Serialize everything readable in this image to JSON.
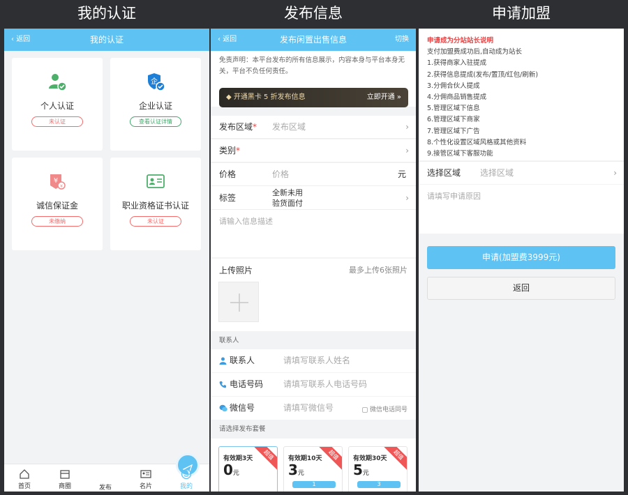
{
  "captions": [
    "我的认证",
    "发布信息",
    "申请加盟"
  ],
  "colors": {
    "accent": "#5ec2f3",
    "danger": "#f36b6b",
    "success": "#3fa86a"
  },
  "panel1": {
    "back": "返回",
    "title": "我的认证",
    "cards": [
      {
        "name": "个人认证",
        "status": "未认证",
        "icon": "person-check-icon"
      },
      {
        "name": "企业认证",
        "status": "查看认证详情",
        "icon": "shield-check-icon"
      },
      {
        "name": "诚信保证金",
        "status": "未缴纳",
        "icon": "yen-badge-icon"
      },
      {
        "name": "职业资格证书认证",
        "status": "未认证",
        "icon": "id-card-icon"
      }
    ],
    "tabs": [
      "首页",
      "商圈",
      "发布",
      "名片",
      "我的"
    ]
  },
  "panel2": {
    "back": "返回",
    "title": "发布闲置出售信息",
    "switch": "切换",
    "disclaimer": "免责声明：本平台发布的所有信息展示，内容本身与平台本身无关，平台不负任何责任。",
    "vip_text": "开通黑卡 5 折发布信息",
    "vip_action": "立即开通 »",
    "fields": {
      "region_label": "发布区域",
      "region_placeholder": "发布区域",
      "category_label": "类别",
      "price_label": "价格",
      "price_placeholder": "价格",
      "price_unit": "元",
      "tag_label": "标签",
      "tags": [
        "全新未用",
        "验货面付"
      ]
    },
    "desc_placeholder": "请输入信息描述",
    "upload_title": "上传照片",
    "upload_hint": "最多上传6张照片",
    "contact_section": "联系人",
    "contact": {
      "name_label": "联系人",
      "name_placeholder": "请填写联系人姓名",
      "phone_label": "电话号码",
      "phone_placeholder": "请填写联系人电话号码",
      "wechat_label": "微信号",
      "wechat_placeholder": "请填写微信号",
      "wechat_same": "微信电话同号"
    },
    "plan_section": "请选择发布套餐",
    "plans": [
      {
        "title": "有效期3天",
        "price": "0",
        "unit": "元",
        "ribbon": "超值",
        "bar": ""
      },
      {
        "title": "有效期10天",
        "price": "3",
        "unit": "元",
        "ribbon": "超值",
        "bar": "1"
      },
      {
        "title": "有效期30天",
        "price": "5",
        "unit": "元",
        "ribbon": "超值",
        "bar": "3"
      }
    ]
  },
  "panel3": {
    "notice_title": "申请成为分站站长说明",
    "notice_lines": [
      "支付加盟费成功后,自动成为站长",
      "1.获得商家入驻提成",
      "2.获得信息提成(发布/置顶/红包/刷新)",
      "3.分佣合伙人提成",
      "4.分佣商品销售提成",
      "5.管理区域下信息",
      "6.管理区域下商家",
      "7.管理区域下广告",
      "8.个性化设置区域风格或其他资料",
      "9.接管区域下客服功能"
    ],
    "region_label": "选择区域",
    "region_placeholder": "选择区域",
    "reason_placeholder": "请填写申请原因",
    "apply_button": "申请(加盟费3999元)",
    "back_button": "返回"
  }
}
